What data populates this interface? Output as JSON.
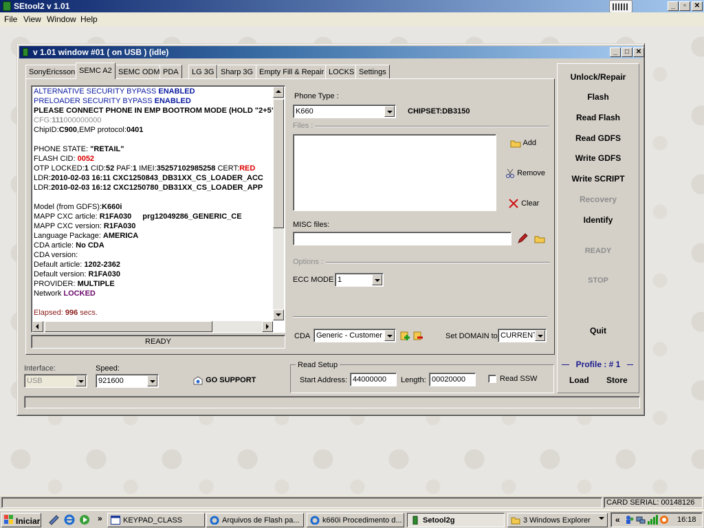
{
  "app": {
    "title": "SEtool2 v 1.01"
  },
  "menu": [
    "File",
    "View",
    "Window",
    "Help"
  ],
  "window": {
    "title": "v 1.01 window #01 ( on USB ) (idle)"
  },
  "tabs": [
    "SonyEricsson",
    "SEMC A2",
    "SEMC ODM",
    "PDA",
    "LG 3G",
    "Sharp 3G",
    "Empty Fill & Repair",
    "LOCKS",
    "Settings"
  ],
  "active_tab": "SEMC A2",
  "log": {
    "l1a": "ALTERNATIVE SECURITY BYPASS ",
    "l1b": "ENABLED",
    "l2a": "PRELOADER SECURITY BYPASS ",
    "l2b": "ENABLED",
    "l3": "PLEASE CONNECT PHONE IN EMP BOOTROM MODE (HOLD \"2+5\")",
    "l4a": "CFG:",
    "l4b": "111",
    "l4c": "000000000",
    "l5a": "ChipID:",
    "l5b": "C900",
    "l5c": ",EMP protocol:",
    "l5d": "0401",
    "l6a": "PHONE STATE: ",
    "l6b": "\"RETAIL\"",
    "l7a": "FLASH CID: ",
    "l7b": "0052",
    "l8a": "OTP LOCKED:",
    "l8b": "1",
    "l8c": " CID:",
    "l8d": "52",
    "l8e": " PAF:",
    "l8f": "1",
    "l8g": " IMEI:",
    "l8h": "35257102985258",
    "l8i": " CERT:",
    "l8j": "RED",
    "l9a": "LDR:",
    "l9b": "2010-02-03 16:11 CXC1250843_DB31XX_CS_LOADER_ACC",
    "l10a": "LDR:",
    "l10b": "2010-02-03 16:12 CXC1250780_DB31XX_CS_LOADER_APP",
    "l11a": "Model (from GDFS):",
    "l11b": "K660i",
    "l12a": "MAPP CXC article: ",
    "l12b": "R1FA030",
    "l12c": "prg12049286_GENERIC_CE",
    "l13a": "MAPP CXC version: ",
    "l13b": "R1FA030",
    "l14a": "Language Package: ",
    "l14b": "AMERICA",
    "l15a": "CDA article: ",
    "l15b": "No CDA",
    "l16a": "CDA version:",
    "l17a": "Default article: ",
    "l17b": "1202-2362",
    "l18a": "Default version: ",
    "l18b": "R1FA030",
    "l19a": "PROVIDER: ",
    "l19b": "MULTIPLE",
    "l20a": "Network ",
    "l20b": "LOCKED",
    "l21a": "Elapsed: ",
    "l21b": "996",
    "l21c": " secs."
  },
  "log_status": "READY",
  "phone_type": {
    "label": "Phone Type :",
    "value": "K660",
    "chipset": "CHIPSET:DB3150"
  },
  "files": {
    "label": "Files :",
    "add": "Add",
    "remove": "Remove",
    "clear": "Clear"
  },
  "misc": {
    "label": "MISC files:",
    "value": ""
  },
  "options": {
    "label": "Options :",
    "ecc_label": "ECC MODE",
    "ecc_value": "1"
  },
  "cda": {
    "label": "CDA",
    "value": "Generic - Customer S",
    "domain_label": "Set DOMAIN to",
    "domain_value": "CURRENT"
  },
  "right_panel": {
    "buttons": [
      "Unlock/Repair",
      "Flash",
      "Read Flash",
      "Read GDFS",
      "Write GDFS",
      "Write SCRIPT",
      "Recovery",
      "Identify"
    ],
    "ready": "READY",
    "stop": "STOP",
    "quit": "Quit",
    "profile": "Profile : # 1",
    "load": "Load",
    "store": "Store"
  },
  "interface": {
    "label": "Interface:",
    "value": "USB"
  },
  "speed": {
    "label": "Speed:",
    "value": "921600"
  },
  "go_support": "GO SUPPORT",
  "read_setup": {
    "label": "Read Setup",
    "start_label": "Start Address:",
    "start_value": "44000000",
    "length_label": "Length:",
    "length_value": "00020000",
    "ssw_label": "Read SSW"
  },
  "card_serial": "CARD SERIAL: 00148126",
  "taskbar": {
    "start": "Iniciar",
    "items": [
      "KEYPAD_CLASS",
      "Arquivos de Flash pa...",
      "k660i Procedimento d...",
      "Setool2g",
      "3 Windows Explorer"
    ],
    "clock": "16:18",
    "tray_expand": "«",
    "more": "»"
  },
  "colors": {
    "title_dark": "#0a246a",
    "title_light": "#a6caf0",
    "profile_blue": "#1a1a8c"
  }
}
